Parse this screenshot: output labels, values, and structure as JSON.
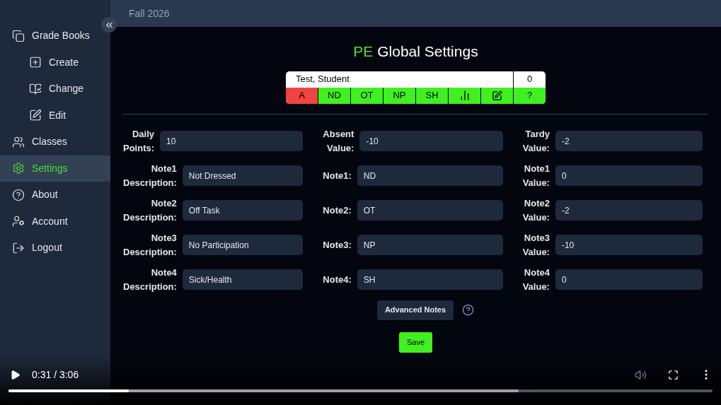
{
  "top_bar": {
    "term": "Fall 2026"
  },
  "sidebar": {
    "items": [
      {
        "label": "Grade Books",
        "selected": false,
        "children": [
          {
            "label": "Create",
            "selected": false
          },
          {
            "label": "Change",
            "selected": false
          },
          {
            "label": "Edit",
            "selected": false
          }
        ]
      },
      {
        "label": "Classes",
        "selected": false
      },
      {
        "label": "Settings",
        "selected": true
      },
      {
        "label": "About",
        "selected": false
      },
      {
        "label": "Account",
        "selected": false
      },
      {
        "label": "Logout",
        "selected": false
      }
    ]
  },
  "page": {
    "title_prefix": "PE",
    "title": "Global Settings"
  },
  "student_card": {
    "name": "Test, Student",
    "score": "0",
    "buttons": [
      {
        "kind": "text",
        "label": "A",
        "selected": true
      },
      {
        "kind": "text",
        "label": "ND",
        "selected": false
      },
      {
        "kind": "text",
        "label": "OT",
        "selected": false
      },
      {
        "kind": "text",
        "label": "NP",
        "selected": false
      },
      {
        "kind": "text",
        "label": "SH",
        "selected": false
      },
      {
        "kind": "chart",
        "selected": false
      },
      {
        "kind": "edit",
        "selected": false
      },
      {
        "kind": "text",
        "label": "?",
        "selected": false
      }
    ]
  },
  "form": {
    "columns": [
      [
        {
          "label": "Daily Points:",
          "value": "10"
        },
        {
          "label": "Note1 Description:",
          "value": "Not Dressed"
        },
        {
          "label": "Note2 Description:",
          "value": "Off Task"
        },
        {
          "label": "Note3 Description:",
          "value": "No Participation"
        },
        {
          "label": "Note4 Description:",
          "value": "Sick/Health"
        }
      ],
      [
        {
          "label": "Absent Value:",
          "value": "-10"
        },
        {
          "label": "Note1:",
          "value": "ND"
        },
        {
          "label": "Note2:",
          "value": "OT"
        },
        {
          "label": "Note3:",
          "value": "NP"
        },
        {
          "label": "Note4:",
          "value": "SH"
        }
      ],
      [
        {
          "label": "Tardy Value:",
          "value": "-2"
        },
        {
          "label": "Note1 Value:",
          "value": "0"
        },
        {
          "label": "Note2 Value:",
          "value": "-2"
        },
        {
          "label": "Note3 Value:",
          "value": "-10"
        },
        {
          "label": "Note4 Value:",
          "value": "0"
        }
      ]
    ],
    "advanced_button": "Advanced Notes",
    "save_button": "Save"
  },
  "player": {
    "time": "0:31 / 3:06",
    "progress": {
      "level": 0.171
    },
    "buffer": {
      "level": 0.725
    }
  }
}
